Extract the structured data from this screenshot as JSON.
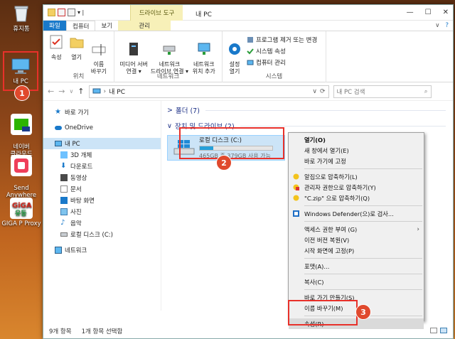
{
  "desktop": {
    "icons": [
      {
        "label": "휴지통"
      },
      {
        "label": "내 PC"
      },
      {
        "label": "네이버\n클라우드"
      },
      {
        "label": "Send\nAnywhere"
      },
      {
        "label": "GIGA P Proxy"
      }
    ],
    "badges": [
      "1",
      "2",
      "3"
    ]
  },
  "window": {
    "context_tab": "드라이브 도구",
    "title": "내 PC",
    "controls": [
      "—",
      "☐",
      "✕"
    ],
    "tabs": [
      {
        "label": "파일"
      },
      {
        "label": "컴퓨터"
      },
      {
        "label": "보기"
      },
      {
        "label": "관리"
      }
    ],
    "ribbon": {
      "groups": [
        {
          "name": "위치",
          "buttons": [
            "속성",
            "열기",
            "이름\n바꾸기"
          ]
        },
        {
          "name": "네트워크",
          "buttons": [
            "미디어 서버\n연결 ▾",
            "네트워크\n드라이브 연결 ▾",
            "네트워크\n위치 추가"
          ]
        },
        {
          "name": "시스템",
          "buttons": [
            "설정\n열기"
          ],
          "small_buttons": [
            "프로그램 제거 또는 변경",
            "시스템 속성",
            "컴퓨터 관리"
          ]
        }
      ]
    },
    "address": {
      "path": "내 PC",
      "search_placeholder": "내 PC 검색"
    },
    "nav_pane": [
      {
        "label": "바로 가기",
        "icon": "star-icon"
      },
      {
        "label": "OneDrive",
        "icon": "cloud-icon"
      },
      {
        "label": "내 PC",
        "icon": "pc-icon"
      },
      {
        "label": "3D 개체",
        "icon": "cube-icon"
      },
      {
        "label": "다운로드",
        "icon": "download-icon"
      },
      {
        "label": "동영상",
        "icon": "video-icon"
      },
      {
        "label": "문서",
        "icon": "document-icon"
      },
      {
        "label": "바탕 화면",
        "icon": "desktop-icon"
      },
      {
        "label": "사진",
        "icon": "picture-icon"
      },
      {
        "label": "음악",
        "icon": "music-icon"
      },
      {
        "label": "로컬 디스크 (C:)",
        "icon": "drive-icon"
      },
      {
        "label": "네트워크",
        "icon": "network-icon"
      }
    ],
    "sections": [
      {
        "label": "폴더 (7)",
        "chevron": ">"
      },
      {
        "label": "장치 및 드라이브 (2)",
        "chevron": "∨"
      }
    ],
    "drive": {
      "name": "로컬 디스크 (C:)",
      "size_text": "465GB 중 379GB 사용 가능",
      "used_fraction": 0.19
    },
    "status": {
      "items": "9개 항목",
      "selected": "1개 항목 선택함"
    }
  },
  "context_menu": {
    "items": [
      {
        "label": "열기(O)",
        "bold": true
      },
      {
        "label": "새 창에서 열기(E)"
      },
      {
        "label": "바로 가기에 고정"
      },
      {
        "sep": true
      },
      {
        "label": "알집으로 압축하기(L)",
        "icon": "alzip-icon"
      },
      {
        "label": "관리자 권한으로 압축하기(Y)",
        "icon": "alzip-admin-icon"
      },
      {
        "label": "\"C.zip\" 으로 압축하기(Q)",
        "icon": "alzip-icon"
      },
      {
        "sep": true
      },
      {
        "label": "Windows Defender(으)로 검사...",
        "icon": "defender-icon"
      },
      {
        "sep": true
      },
      {
        "label": "액세스 권한 부여 (G)",
        "submenu": true
      },
      {
        "label": "이전 버전 복원(V)"
      },
      {
        "label": "시작 화면에 고정(P)"
      },
      {
        "sep": true
      },
      {
        "label": "포맷(A)..."
      },
      {
        "sep": true
      },
      {
        "label": "복사(C)"
      },
      {
        "sep": true
      },
      {
        "label": "바로 가기 만들기(S)"
      },
      {
        "label": "이름 바꾸기(M)"
      },
      {
        "sep": true
      },
      {
        "label": "속성(R)",
        "highlight": true
      }
    ]
  },
  "colors": {
    "accent": "#1979ca",
    "selection": "#cce4f7",
    "annotation": "#e8312a",
    "badge": "#e0492d"
  }
}
